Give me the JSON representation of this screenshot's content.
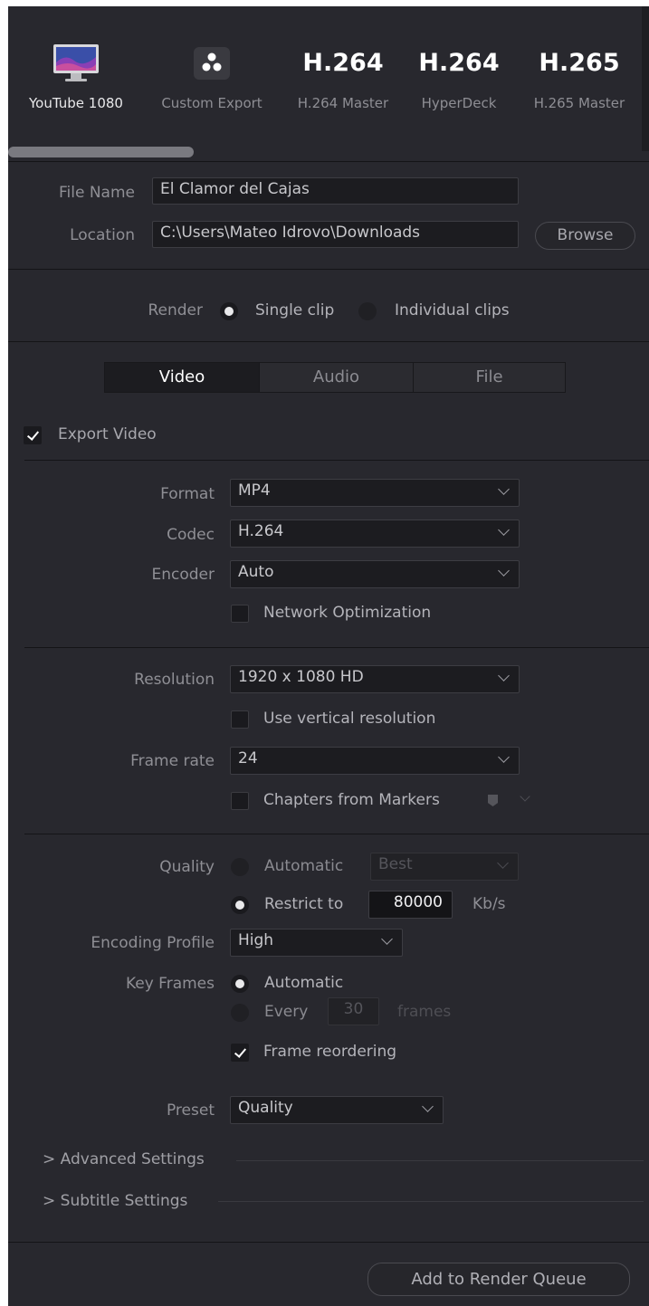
{
  "presets": [
    {
      "icon_text": "",
      "icon": "monitor-icon",
      "caption": "YouTube 1080",
      "active": true
    },
    {
      "icon_text": "",
      "icon": "davinci-logo-icon",
      "caption": "Custom Export"
    },
    {
      "icon_text": "H.264",
      "caption": "H.264 Master"
    },
    {
      "icon_text": "H.264",
      "caption": "HyperDeck"
    },
    {
      "icon_text": "H.265",
      "caption": "H.265 Master"
    }
  ],
  "file": {
    "file_name_label": "File Name",
    "file_name_value": "El Clamor del Cajas",
    "location_label": "Location",
    "location_value": "C:\\Users\\Mateo Idrovo\\Downloads",
    "browse_label": "Browse"
  },
  "render": {
    "label": "Render",
    "single_clip": "Single clip",
    "individual_clips": "Individual clips"
  },
  "tabs": [
    "Video",
    "Audio",
    "File"
  ],
  "export_video_label": "Export Video",
  "video": {
    "format_label": "Format",
    "format_value": "MP4",
    "codec_label": "Codec",
    "codec_value": "H.264",
    "encoder_label": "Encoder",
    "encoder_value": "Auto",
    "network_opt_label": "Network Optimization",
    "resolution_label": "Resolution",
    "resolution_value": "1920 x 1080 HD",
    "vertical_res_label": "Use vertical resolution",
    "frame_rate_label": "Frame rate",
    "frame_rate_value": "24",
    "chapters_label": "Chapters from Markers"
  },
  "quality": {
    "label": "Quality",
    "automatic_label": "Automatic",
    "automatic_value": "Best",
    "restrict_label": "Restrict to",
    "restrict_value": "80000",
    "restrict_unit": "Kb/s",
    "encoding_profile_label": "Encoding Profile",
    "encoding_profile_value": "High",
    "key_frames_label": "Key Frames",
    "kf_automatic": "Automatic",
    "kf_every": "Every",
    "kf_every_value": "30",
    "kf_frames": "frames",
    "frame_reordering": "Frame reordering",
    "preset_label": "Preset",
    "preset_value": "Quality"
  },
  "sections": {
    "advanced": "> Advanced Settings",
    "subtitle": "> Subtitle Settings"
  },
  "add_to_queue_label": "Add to Render Queue",
  "colors": {
    "panel": "#28282e",
    "field": "#1c1c20",
    "text": "#a0a0a6"
  }
}
